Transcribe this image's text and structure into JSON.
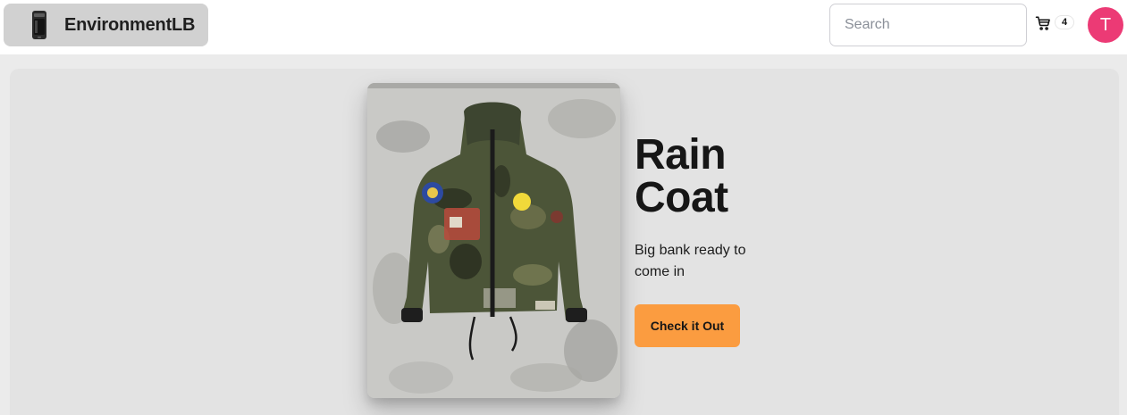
{
  "navbar": {
    "brand_name": "EnvironmentLB",
    "logo_icon": "phone-logo-icon",
    "search": {
      "placeholder": "Search",
      "value": ""
    },
    "cart": {
      "icon": "cart-icon",
      "count": "4"
    },
    "avatar_initial": "T",
    "avatar_color": "#ec3a75"
  },
  "hero": {
    "title": "Rain Coat",
    "description": "Big bank ready to come in",
    "cta_label": "Check it Out",
    "cta_color": "#fb9c40",
    "image": "camo-jacket-product-photo"
  }
}
